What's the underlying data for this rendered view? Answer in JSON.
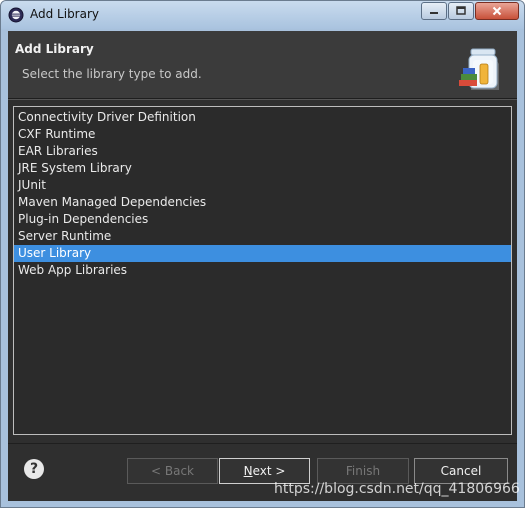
{
  "window": {
    "title": "Add Library",
    "colors": {
      "titlebar": "#a9c3df",
      "close": "#c8513a",
      "selection": "#3d8fe0"
    }
  },
  "header": {
    "title": "Add Library",
    "subtitle": "Select the library type to add.",
    "icon": "library-jar-icon"
  },
  "library_types": [
    {
      "label": "Connectivity Driver Definition",
      "selected": false
    },
    {
      "label": "CXF Runtime",
      "selected": false
    },
    {
      "label": "EAR Libraries",
      "selected": false
    },
    {
      "label": "JRE System Library",
      "selected": false
    },
    {
      "label": "JUnit",
      "selected": false
    },
    {
      "label": "Maven Managed Dependencies",
      "selected": false
    },
    {
      "label": "Plug-in Dependencies",
      "selected": false
    },
    {
      "label": "Server Runtime",
      "selected": false
    },
    {
      "label": "User Library",
      "selected": true
    },
    {
      "label": "Web App Libraries",
      "selected": false
    }
  ],
  "footer": {
    "help": "?",
    "back": "< Back",
    "next_mnemonic": "N",
    "next_rest": "ext >",
    "finish": "Finish",
    "cancel": "Cancel"
  },
  "watermark": "https://blog.csdn.net/qq_41806966"
}
